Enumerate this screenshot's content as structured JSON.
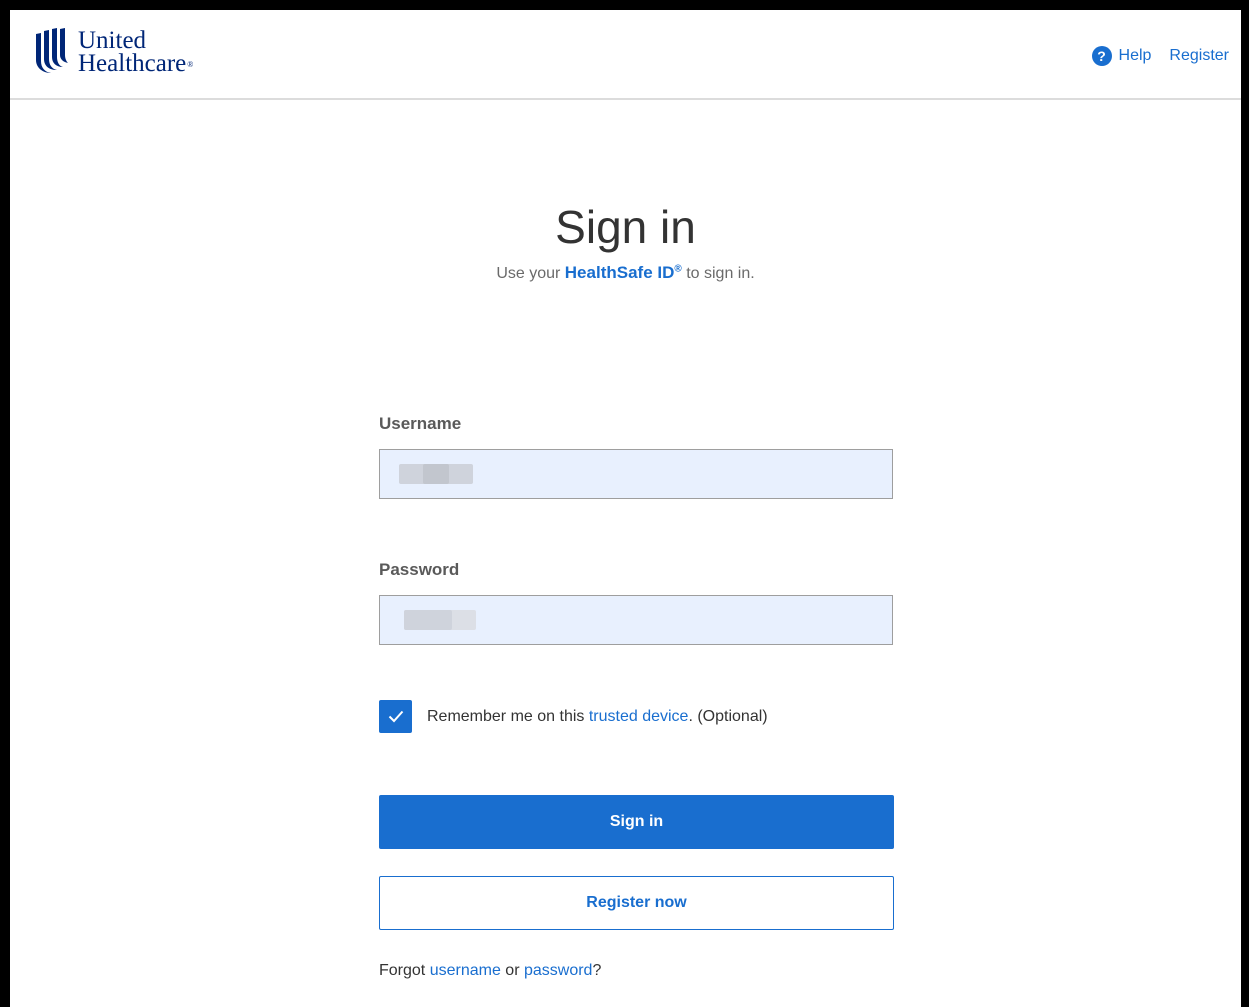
{
  "header": {
    "logo_line1": "United",
    "logo_line2": "Healthcare",
    "logo_reg": "®",
    "help_label": "Help",
    "help_icon_glyph": "?",
    "register_label": "Register"
  },
  "page": {
    "title": "Sign in",
    "intro_before": "Use your ",
    "intro_link": "HealthSafe ID",
    "intro_reg": "®",
    "intro_after": " to sign in."
  },
  "form": {
    "username_label": "Username",
    "password_label": "Password",
    "remember_before": "Remember me on this ",
    "remember_link": "trusted device",
    "remember_after": ". (Optional)",
    "remember_checked": true,
    "sign_in_button": "Sign in",
    "register_button": "Register now",
    "forgot_before": "Forgot ",
    "forgot_username": "username",
    "forgot_or": " or ",
    "forgot_password": "password",
    "forgot_after": "?"
  },
  "colors": {
    "brand_navy": "#002677",
    "link_blue": "#196ecf",
    "field_fill": "#e8f0fe"
  },
  "icons": {
    "logo": "uhc-logo-icon",
    "help": "help-circle-icon",
    "checkbox": "checkmark-icon"
  }
}
